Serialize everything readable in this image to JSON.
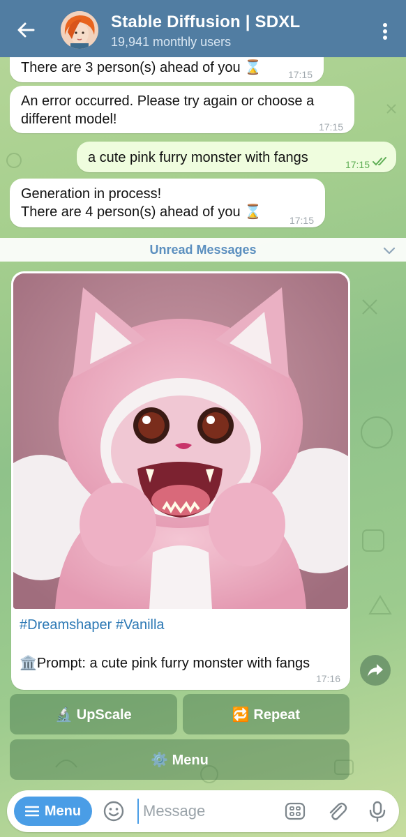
{
  "header": {
    "title": "Stable Diffusion | SDXL",
    "subtitle": "19,941 monthly users"
  },
  "messages": [
    {
      "text": "There are 3 person(s) ahead of you ⌛",
      "time": "17:15"
    },
    {
      "text_lines": [
        "An error occurred. Please try again or choose a",
        "different model!"
      ],
      "time": "17:15"
    },
    {
      "text": "a cute pink furry monster with fangs",
      "time": "17:15",
      "outgoing": true
    },
    {
      "text_lines": [
        "Generation in process!",
        "There are 4 person(s) ahead of you ⌛"
      ],
      "time": "17:15"
    }
  ],
  "unread_label": "Unread Messages",
  "photo_message": {
    "hashtags": "#Dreamshaper #Vanilla",
    "prompt": "🏛️Prompt: a cute pink furry monster with fangs",
    "time": "17:16"
  },
  "keyboard": {
    "upscale": "🔬 UpScale",
    "repeat": "🔁 Repeat",
    "menu": "⚙️ Menu"
  },
  "input": {
    "menu_label": "Menu",
    "placeholder": "Message"
  },
  "colors": {
    "header": "#517da2",
    "accent": "#4a9de6",
    "outgoing_bubble": "#effdde"
  }
}
